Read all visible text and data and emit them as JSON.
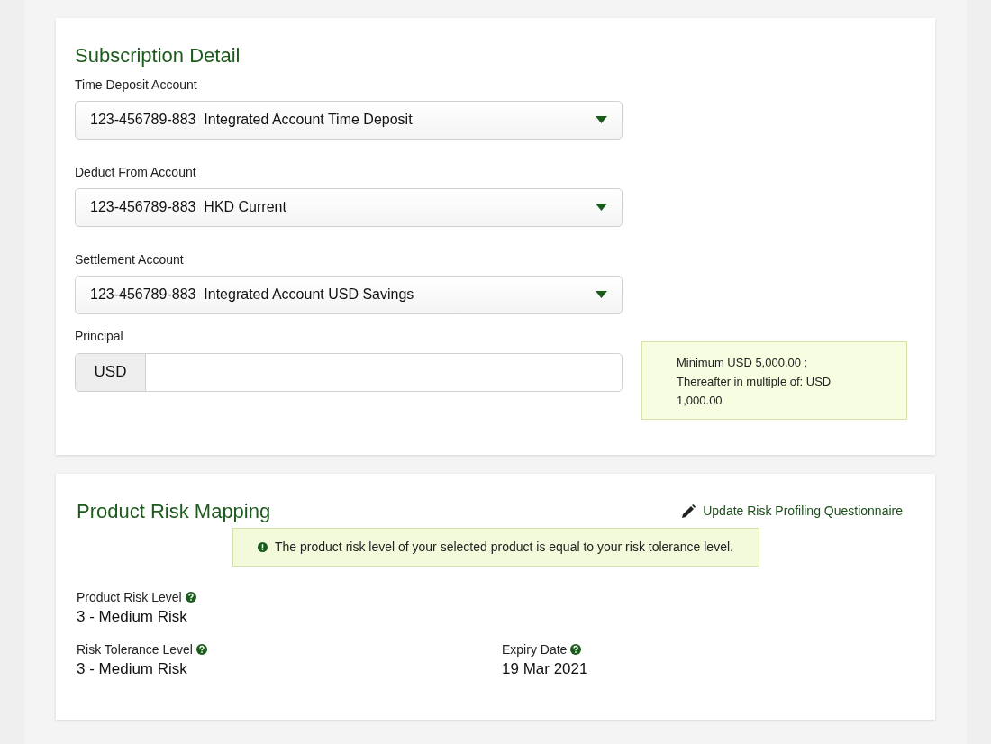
{
  "subscription": {
    "title": "Subscription Detail",
    "selects": [
      {
        "label": "Time Deposit Account",
        "number": "123-456789-883",
        "name": "Integrated Account Time Deposit"
      },
      {
        "label": "Deduct From Account",
        "number": "123-456789-883",
        "name": "HKD Current"
      },
      {
        "label": "Settlement Account",
        "number": "123-456789-883",
        "name": "Integrated Account USD Savings"
      }
    ],
    "principal": {
      "label": "Principal",
      "currency": "USD"
    },
    "note": [
      "Minimum USD 5,000.00 ;",
      "Thereafter in multiple of: USD 1,000.00"
    ]
  },
  "risk": {
    "title": "Product Risk Mapping",
    "link": "Update Risk Profiling Questionnaire",
    "alert": "The product risk level of your selected product is equal to your risk tolerance level.",
    "fields": [
      {
        "label": "Product Risk Level",
        "value": "3 - Medium Risk"
      },
      {
        "label": "Risk Tolerance Level",
        "value": "3 - Medium Risk"
      },
      {
        "label": "Expiry Date",
        "value": "19 Mar 2021"
      }
    ]
  }
}
